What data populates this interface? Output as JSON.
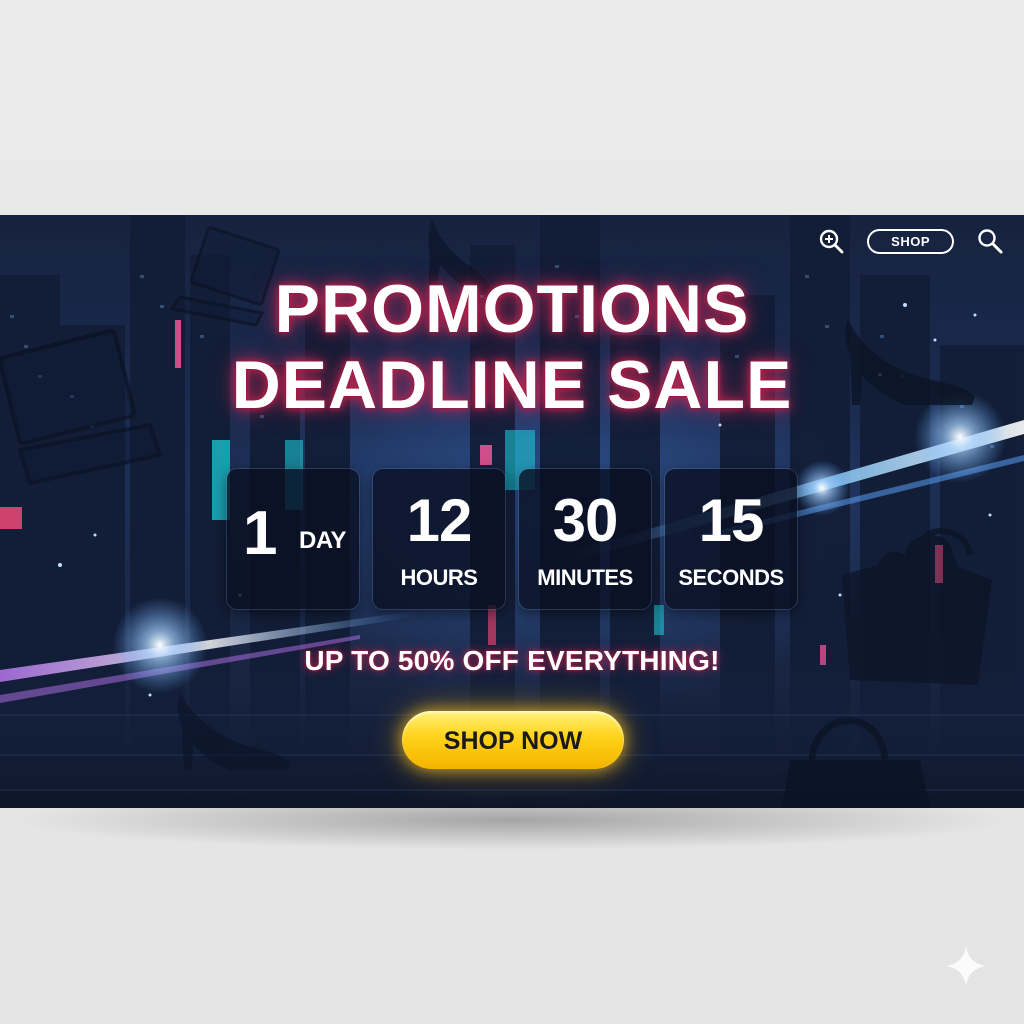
{
  "nav": {
    "icons": [
      "zoom-in-icon",
      "search-icon"
    ],
    "shop_label": "SHOP"
  },
  "headline": {
    "line1": "PROMOTIONS",
    "line2": "DEADLINE SALE"
  },
  "countdown": [
    {
      "value": "1",
      "unit": "DAY"
    },
    {
      "value": "12",
      "unit": "HOURS"
    },
    {
      "value": "30",
      "unit": "MINUTES"
    },
    {
      "value": "15",
      "unit": "SECONDS"
    }
  ],
  "offer_text": "UP TO 50% OFF EVERYTHING!",
  "cta_label": "SHOP NOW",
  "colors": {
    "background": "#1d2f56",
    "headline_glow": "#e6285a",
    "cta": "#ffd21a",
    "laser_blue": "#5fa8ff",
    "laser_violet": "#c77dff"
  },
  "decor_icons": [
    "laptop-icon",
    "high-heel-icon",
    "handbag-icon",
    "sparkle-icon"
  ]
}
